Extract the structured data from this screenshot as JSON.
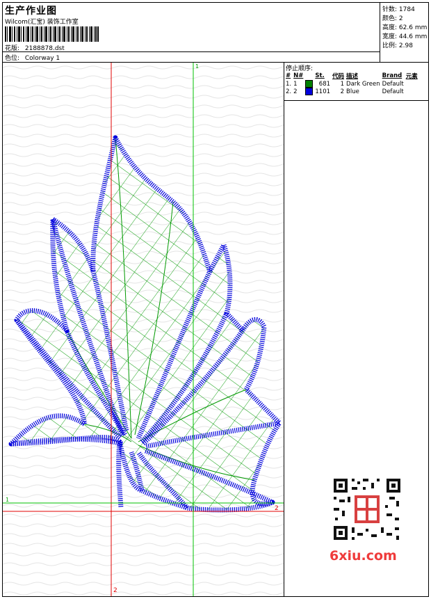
{
  "header": {
    "title": "生产作业图",
    "software": "Wilcom(汇宝) 装饰工作室",
    "design_label": "花版:",
    "design_value": "2188878.dst",
    "color_label": "色位:",
    "color_value": "Colorway 1"
  },
  "stats": [
    {
      "label": "针数:",
      "value": "1784"
    },
    {
      "label": "颜色:",
      "value": "2"
    },
    {
      "label": "高度:",
      "value": "62.6 mm"
    },
    {
      "label": "宽度:",
      "value": "44.6 mm"
    },
    {
      "label": "比例:",
      "value": "2.98"
    }
  ],
  "stop_sequence": {
    "heading": "停止顺序:",
    "columns": [
      "#",
      "N#",
      "St.",
      "代码",
      "描述",
      "Brand",
      "元素"
    ],
    "rows": [
      {
        "idx": "1.",
        "n": "1",
        "color": "#008000",
        "st": "681",
        "code": "1",
        "desc": "Dark Green",
        "brand": "Default"
      },
      {
        "idx": "2.",
        "n": "2",
        "color": "#0000dd",
        "st": "1101",
        "code": "2",
        "desc": "Blue",
        "brand": "Default"
      }
    ]
  },
  "axes": {
    "green_top": "1",
    "green_left": "1",
    "red_right": "2",
    "red_bottom": "2"
  },
  "watermark": "6xiu.com",
  "colors": {
    "green_thread": "#009900",
    "blue_thread": "#0000dd",
    "red_axis": "#e00000",
    "green_axis": "#00c000"
  }
}
